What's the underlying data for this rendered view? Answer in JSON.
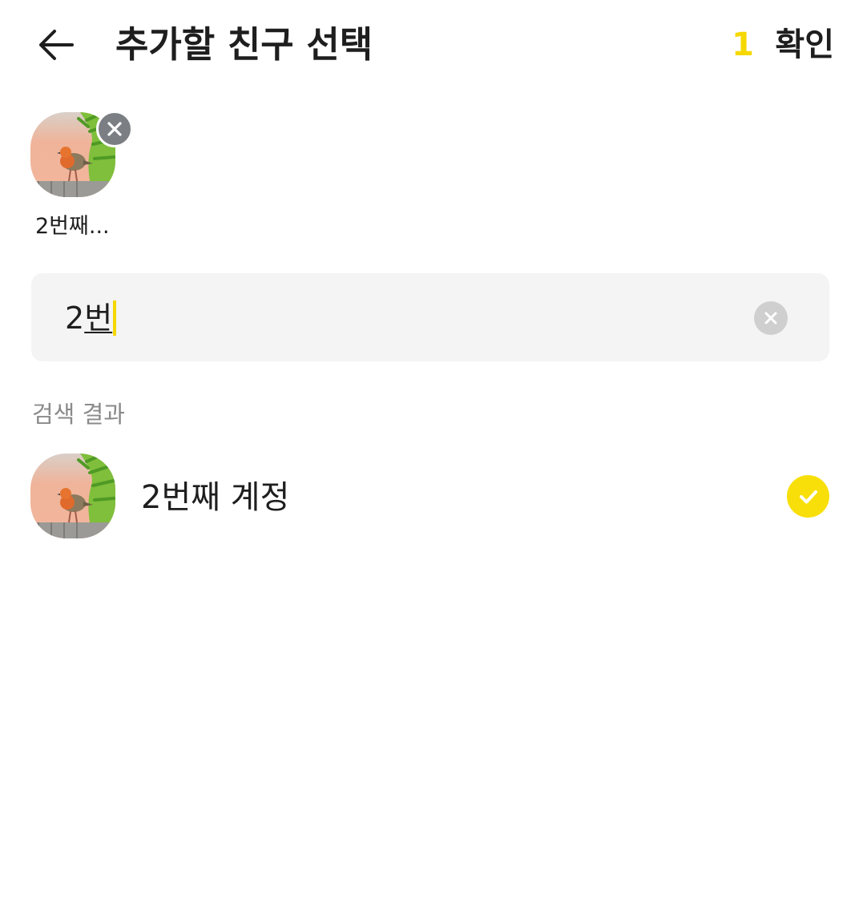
{
  "header": {
    "back_icon": "arrow-left-icon",
    "title": "추가할 친구 선택",
    "selected_count": "1",
    "confirm_label": "확인",
    "accent_color": "#f5d800"
  },
  "selected_friends": [
    {
      "name": "2번째...",
      "avatar_icon": "bird-photo",
      "remove_icon": "close-icon"
    }
  ],
  "search": {
    "committed_text": "2",
    "composing_text": "번",
    "clear_icon": "clear-circle-icon"
  },
  "results": {
    "section_label": "검색 결과",
    "items": [
      {
        "name": "2번째 계정",
        "avatar_icon": "bird-photo",
        "selected": true,
        "check_icon": "check-circle-icon"
      }
    ]
  }
}
